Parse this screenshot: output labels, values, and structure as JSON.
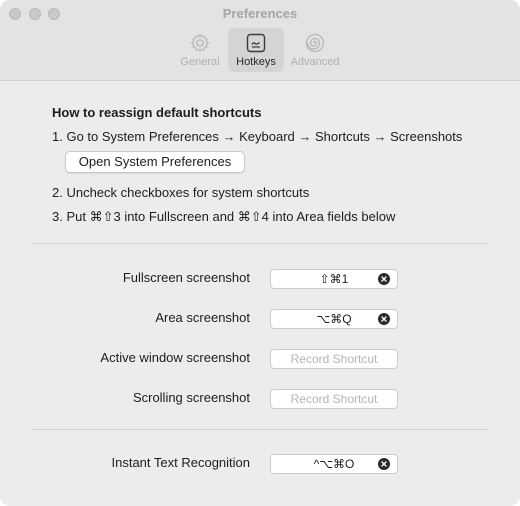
{
  "window": {
    "title": "Preferences"
  },
  "tabs": [
    {
      "label": "General",
      "icon": "gear-icon",
      "active": false
    },
    {
      "label": "Hotkeys",
      "icon": "keyboard-icon",
      "active": true
    },
    {
      "label": "Advanced",
      "icon": "spiral-icon",
      "active": false
    }
  ],
  "instructions": {
    "heading": "How to reassign default shortcuts",
    "step1": "1. Go to System Preferences → Keyboard → Shortcuts → Screenshots",
    "open_button": "Open System Preferences",
    "step2": "2. Uncheck checkboxes for system shortcuts",
    "step3": "3. Put ⌘⇧3 into Fullscreen and ⌘⇧4 into Area fields below"
  },
  "shortcuts": [
    {
      "label": "Fullscreen screenshot",
      "value": "⇧⌘1",
      "placeholder": ""
    },
    {
      "label": "Area screenshot",
      "value": "⌥⌘Q",
      "placeholder": ""
    },
    {
      "label": "Active window screenshot",
      "value": "",
      "placeholder": "Record Shortcut"
    },
    {
      "label": "Scrolling screenshot",
      "value": "",
      "placeholder": "Record Shortcut"
    },
    {
      "label": "Instant Text Recognition",
      "value": "^⌥⌘O",
      "placeholder": ""
    }
  ],
  "colors": {
    "window_bg": "#ececec",
    "titlebar_bg": "#e3e3e3",
    "active_tab_bg": "#d4d4d4",
    "inactive_text": "#b0b0b0",
    "clear_button": "#2b2b2b"
  }
}
